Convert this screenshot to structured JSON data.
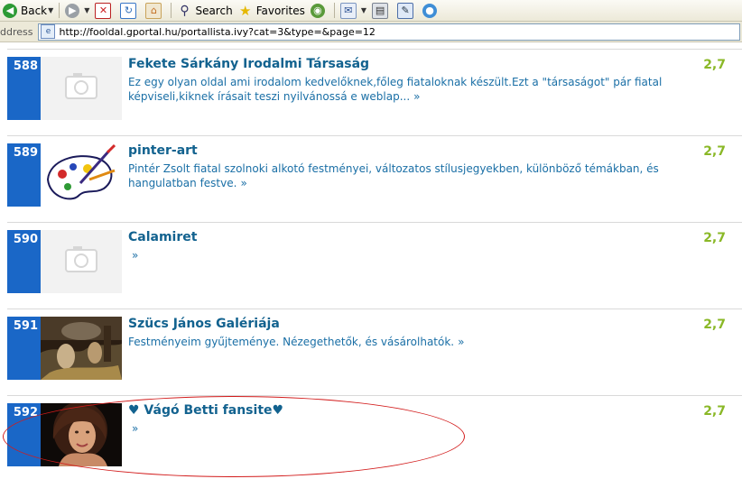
{
  "toolbar": {
    "back_label": "Back",
    "search_label": "Search",
    "favorites_label": "Favorites"
  },
  "address": {
    "label": "ddress",
    "url": "http://fooldal.gportal.hu/portallista.ivy?cat=3&type=&page=12"
  },
  "entries": [
    {
      "rank": "588",
      "title": "Fekete Sárkány Irodalmi Társaság",
      "description": "Ez egy olyan oldal ami irodalom kedvelőknek,főleg fiataloknak készült.Ezt a \"társaságot\" pár fiatal képviseli,kiknek írásait teszi nyilvánossá e weblap...",
      "more": "»",
      "score": "2,7",
      "thumbnail": "placeholder"
    },
    {
      "rank": "589",
      "title": "pinter-art",
      "description": "Pintér Zsolt fiatal szolnoki alkotó festményei, változatos stílusjegyekben, különböző témákban, és hangulatban festve.",
      "more": "»",
      "score": "2,7",
      "thumbnail": "palette"
    },
    {
      "rank": "590",
      "title": "Calamiret",
      "description": "",
      "more": "»",
      "score": "2,7",
      "thumbnail": "placeholder"
    },
    {
      "rank": "591",
      "title": "Szücs János Galériája",
      "description": "Festményeim gyűjteménye. Nézegethetők, és vásárolhatók.",
      "more": "»",
      "score": "2,7",
      "thumbnail": "painting"
    },
    {
      "rank": "592",
      "title": "♥ Vágó Betti fansite♥",
      "description": "",
      "more": "»",
      "score": "2,7",
      "thumbnail": "portrait"
    }
  ],
  "colors": {
    "rank_bg": "#1a67c7",
    "title": "#12628f",
    "description": "#1a6fa6",
    "score": "#8ab827",
    "highlight": "#d21b1b"
  }
}
